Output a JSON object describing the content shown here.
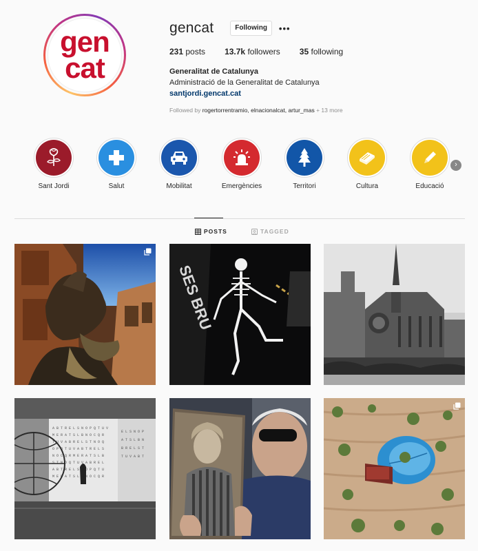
{
  "profile": {
    "avatar_line1": "gen",
    "avatar_line2": "cat",
    "username": "gencat",
    "follow_label": "Following",
    "more_label": "•••",
    "posts_count": "231",
    "posts_label": "posts",
    "followers_count": "13.7k",
    "followers_label": "followers",
    "following_count": "35",
    "following_label": "following",
    "full_name": "Generalitat de Catalunya",
    "description": "Administració de la Generalitat de Catalunya",
    "website": "santjordi.gencat.cat",
    "followed_by_prefix": "Followed by ",
    "followed_by_names": "rogertorrentramio, elnacionalcat, artur_mas",
    "followed_by_suffix": " + 13 more"
  },
  "highlights": [
    {
      "label": "Sant Jordi",
      "color": "#9b1b2a",
      "icon": "rose-icon"
    },
    {
      "label": "Salut",
      "color": "#2a8fe0",
      "icon": "medical-cross-icon"
    },
    {
      "label": "Mobilitat",
      "color": "#1b57ad",
      "icon": "car-icon"
    },
    {
      "label": "Emergències",
      "color": "#d42a2f",
      "icon": "siren-icon"
    },
    {
      "label": "Territori",
      "color": "#1256a8",
      "icon": "tree-icon"
    },
    {
      "label": "Cultura",
      "color": "#f2c21a",
      "icon": "book-icon"
    },
    {
      "label": "Educació",
      "color": "#f2c21a",
      "icon": "pencil-icon"
    }
  ],
  "tabs": {
    "posts": "POSTS",
    "tagged": "TAGGED"
  },
  "posts": [
    {
      "subject": "sant-jordi-statue",
      "multi": true
    },
    {
      "subject": "skeleton-costume",
      "multi": false
    },
    {
      "subject": "notre-dame",
      "multi": false
    },
    {
      "subject": "art-installation",
      "multi": false
    },
    {
      "subject": "portrait-holder",
      "multi": false
    },
    {
      "subject": "aerial-umbrella",
      "multi": true
    }
  ]
}
